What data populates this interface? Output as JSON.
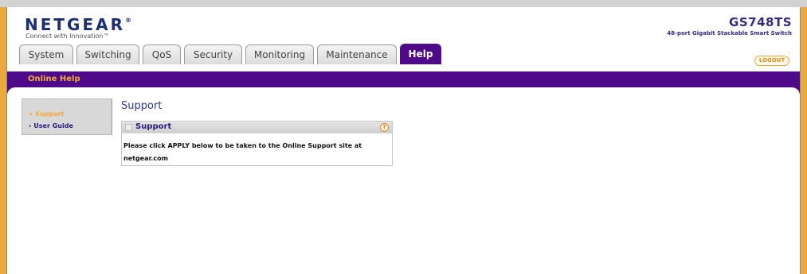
{
  "header": {
    "brand": "NETGEAR",
    "brand_mark": "®",
    "tagline": "Connect with Innovation™",
    "model": "GS748TS",
    "model_description": "48-port Gigabit Stackable Smart Switch"
  },
  "tabs": [
    {
      "label": "System"
    },
    {
      "label": "Switching"
    },
    {
      "label": "QoS"
    },
    {
      "label": "Security"
    },
    {
      "label": "Monitoring"
    },
    {
      "label": "Maintenance"
    },
    {
      "label": "Help",
      "active": true
    }
  ],
  "logout_label": "LOGOUT",
  "subnav": {
    "label": "Online Help"
  },
  "sidebar": {
    "items": [
      {
        "label": "Support",
        "arrow": "»",
        "active": true
      },
      {
        "label": "User Guide",
        "arrow": "›",
        "active": false
      }
    ]
  },
  "main": {
    "title": "Support",
    "panel": {
      "title": "Support",
      "help_icon": "?",
      "text": "Please click APPLY below to be taken to the Online Support site at netgear.com"
    }
  },
  "colors": {
    "accent_purple": "#4f0a89",
    "accent_orange": "#f2a93b",
    "frame_orange": "#e9a93c"
  }
}
